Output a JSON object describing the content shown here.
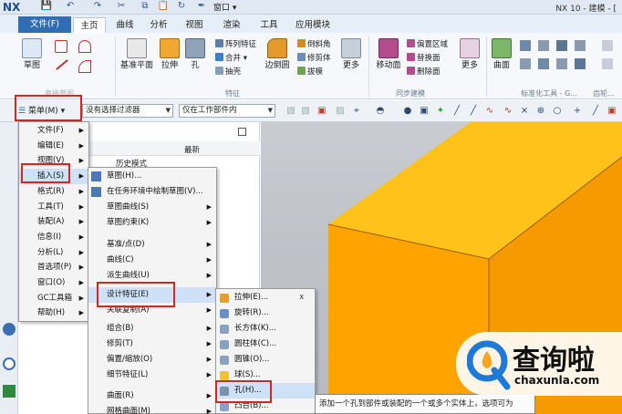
{
  "app": {
    "logo": "NX",
    "window_title": "NX 10 - 建模 - [",
    "window_menu_label": "窗口",
    "colors": {
      "file_tab_bg": "#2f6db5",
      "cube_top": "#ffc018",
      "cube_front": "#ffa800",
      "highlight_box": "#d9251f"
    }
  },
  "tabs": [
    "文件(F)",
    "主页",
    "曲线",
    "分析",
    "视图",
    "渲染",
    "工具",
    "应用模块"
  ],
  "ribbon": {
    "sketch_label": "草图",
    "direct_sketch_group": "直接草图",
    "datum_plane": "基准平面",
    "extrude": "拉伸",
    "hole": "孔",
    "pattern_feature": "阵列特征",
    "unite": "合并",
    "subtract": "抽壳",
    "edge_blend": "边倒圆",
    "chamfer": "倒斜角",
    "trim_body": "修剪体",
    "draft": "拔模",
    "more1": "更多",
    "feature_group": "特征",
    "move_face": "移动面",
    "offset_region": "偏置区域",
    "replace_face": "替换面",
    "delete_face": "删除面",
    "more2": "更多",
    "sync_group": "同步建模",
    "surface": "曲面",
    "std_tools_group": "标准化工具 - G...",
    "gear_group": "齿轮..."
  },
  "toolbar2": {
    "menu_button": "菜单(M)",
    "filter_combo": "没有选择过滤器",
    "scope_combo": "仅在工作部件内"
  },
  "partnav": {
    "col_latest": "最新",
    "model_history": "历史模式"
  },
  "main_menu": [
    {
      "label": "文件(F)",
      "sub": true
    },
    {
      "label": "编辑(E)",
      "sub": true
    },
    {
      "label": "视图(V)",
      "sub": true
    },
    {
      "label": "插入(S)",
      "sub": true,
      "highlight": true
    },
    {
      "label": "格式(R)",
      "sub": true
    },
    {
      "label": "工具(T)",
      "sub": true
    },
    {
      "label": "装配(A)",
      "sub": true
    },
    {
      "label": "信息(I)",
      "sub": true
    },
    {
      "label": "分析(L)",
      "sub": true
    },
    {
      "label": "首选项(P)",
      "sub": true
    },
    {
      "label": "窗口(O)",
      "sub": true
    },
    {
      "label": "GC工具箱",
      "sub": true
    },
    {
      "label": "帮助(H)",
      "sub": true
    }
  ],
  "insert_menu": [
    {
      "label": "草图(H)..."
    },
    {
      "label": "在任务环境中绘制草图(V)..."
    },
    {
      "label": "草图曲线(S)",
      "sub": true
    },
    {
      "label": "草图约束(K)",
      "sub": true
    },
    {
      "label": "基准/点(D)",
      "sub": true
    },
    {
      "label": "曲线(C)",
      "sub": true
    },
    {
      "label": "派生曲线(U)",
      "sub": true
    },
    {
      "label": "设计特征(E)",
      "sub": true,
      "highlight": true
    },
    {
      "label": "关联复制(A)",
      "sub": true
    },
    {
      "label": "组合(B)",
      "sub": true
    },
    {
      "label": "修剪(T)",
      "sub": true
    },
    {
      "label": "偏置/缩放(O)",
      "sub": true
    },
    {
      "label": "细节特征(L)",
      "sub": true
    },
    {
      "label": "曲面(R)",
      "sub": true
    },
    {
      "label": "网格曲面(M)",
      "sub": true
    }
  ],
  "design_feature_menu": [
    {
      "label": "拉伸(E)...",
      "shortcut": "X"
    },
    {
      "label": "旋转(R)..."
    },
    {
      "label": "长方体(K)..."
    },
    {
      "label": "圆柱体(C)..."
    },
    {
      "label": "圆锥(O)..."
    },
    {
      "label": "球(S)..."
    },
    {
      "label": "孔(H)...",
      "highlight": true
    },
    {
      "label": "凸台(B)..."
    }
  ],
  "tooltip": "添加一个孔到部件或装配的一个或多个实体上，选项可为",
  "watermark": {
    "title": "查询啦",
    "url": "chaxunla.com"
  }
}
